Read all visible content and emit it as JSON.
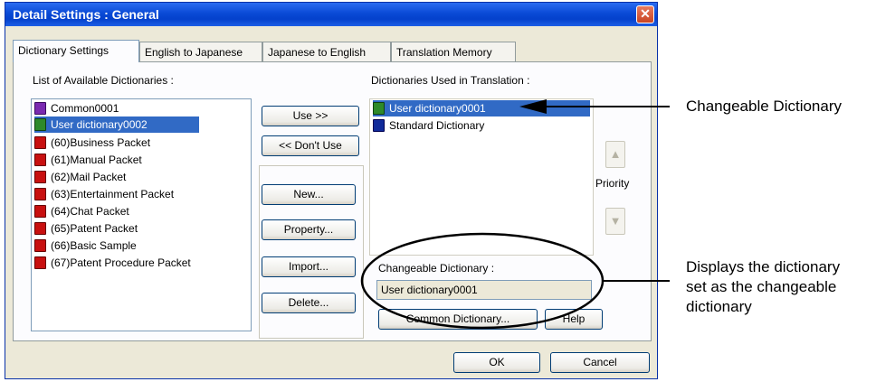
{
  "dialog": {
    "title": "Detail Settings : General",
    "close_glyph": "✕"
  },
  "tabs": [
    {
      "label": "Dictionary Settings"
    },
    {
      "label": "English to Japanese"
    },
    {
      "label": "Japanese to English"
    },
    {
      "label": "Translation Memory"
    }
  ],
  "available": {
    "label": "List of Available Dictionaries :",
    "items": [
      {
        "label": "Common0001",
        "icon": "purple-dictionary-icon"
      },
      {
        "label": "User dictionary0002",
        "icon": "green-user-dictionary-icon",
        "selected": true
      },
      {
        "label": "(60)Business Packet",
        "icon": "red-dictionary-icon"
      },
      {
        "label": "(61)Manual Packet",
        "icon": "red-dictionary-icon"
      },
      {
        "label": "(62)Mail Packet",
        "icon": "red-dictionary-icon"
      },
      {
        "label": "(63)Entertainment Packet",
        "icon": "red-dictionary-icon"
      },
      {
        "label": "(64)Chat Packet",
        "icon": "red-dictionary-icon"
      },
      {
        "label": "(65)Patent Packet",
        "icon": "red-dictionary-icon"
      },
      {
        "label": "(66)Basic Sample",
        "icon": "red-dictionary-icon"
      },
      {
        "label": "(67)Patent Procedure Packet",
        "icon": "red-dictionary-icon"
      }
    ]
  },
  "used": {
    "label": "Dictionaries Used in Translation :",
    "items": [
      {
        "label": "User dictionary0001",
        "icon": "green-checked-dictionary-icon",
        "selected": true
      },
      {
        "label": "Standard Dictionary",
        "icon": "blue-dictionary-icon"
      }
    ]
  },
  "buttons": {
    "use": "Use >>",
    "dont_use": "<< Don't Use",
    "new": "New...",
    "property": "Property...",
    "import": "Import...",
    "delete": "Delete...",
    "common_dictionary": "Common Dictionary...",
    "help": "Help",
    "ok": "OK",
    "cancel": "Cancel",
    "priority_up": "▲",
    "priority_down": "▼"
  },
  "priority_label": "Priority",
  "changeable": {
    "label": "Changeable Dictionary :",
    "value": "User dictionary0001"
  },
  "callouts": {
    "changeable_dictionary": "Changeable Dictionary",
    "displays_line1": "Displays the dictionary",
    "displays_line2": "set as the changeable",
    "displays_line3": "dictionary"
  },
  "colors": {
    "title_bar": "#0a4ad6",
    "selection": "#316ac5",
    "dialog_bg": "#ece9d8"
  }
}
